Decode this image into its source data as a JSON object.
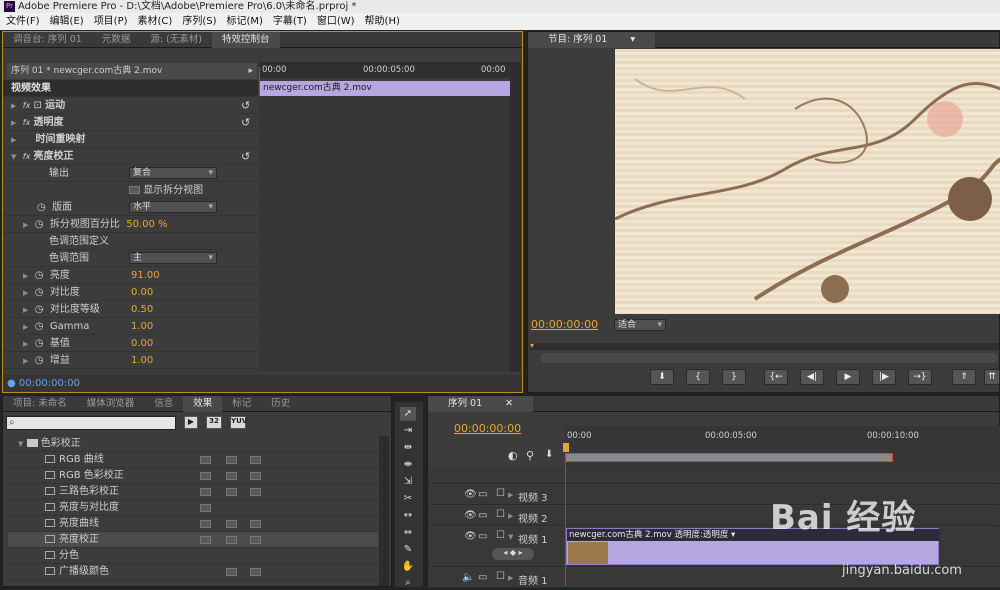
{
  "window": {
    "title": "Adobe Premiere Pro - D:\\文档\\Adobe\\Premiere Pro\\6.0\\未命名.prproj *"
  },
  "menu": [
    "文件(F)",
    "编辑(E)",
    "项目(P)",
    "素材(C)",
    "序列(S)",
    "标记(M)",
    "字幕(T)",
    "窗口(W)",
    "帮助(H)"
  ],
  "top_left_tabs": [
    "调音台: 序列 01",
    "元数据",
    "源: (无素材)",
    "特效控制台"
  ],
  "effect_controls": {
    "clip_header": "序列 01 * newcger.com古典 2.mov",
    "ruler": [
      "00:00",
      "00:00:05:00",
      "00:00"
    ],
    "clip_bar": "newcger.com古典 2.mov",
    "section": "视频效果",
    "rows": [
      {
        "label": "运动"
      },
      {
        "label": "透明度"
      },
      {
        "label": "时间重映射"
      },
      {
        "label": "亮度校正"
      }
    ],
    "props": {
      "output_label": "输出",
      "output_value": "复合",
      "split_label": "显示拆分视图",
      "layout_label": "版面",
      "layout_value": "水平",
      "split_pct_label": "拆分视图百分比",
      "split_pct_value": "50.00 %",
      "tonal_def": "色调范围定义",
      "tonal_label": "色调范围",
      "tonal_value": "主",
      "brightness_label": "亮度",
      "brightness_value": "91.00",
      "contrast_label": "对比度",
      "contrast_value": "0.00",
      "contrast_level_label": "对比度等级",
      "contrast_level_value": "0.50",
      "gamma_label": "Gamma",
      "gamma_value": "1.00",
      "pedestal_label": "基值",
      "pedestal_value": "0.00",
      "gain_label": "增益",
      "gain_value": "1.00"
    },
    "timecode": "00:00:00:00"
  },
  "program": {
    "tab": "节目: 序列 01",
    "timecode": "00:00:00:00",
    "fit": "适合"
  },
  "project_tabs": [
    "项目: 未命名",
    "媒体浏览器",
    "信息",
    "效果",
    "标记",
    "历史"
  ],
  "effects": {
    "folder": "色彩校正",
    "items": [
      "RGB 曲线",
      "RGB 色彩校正",
      "三路色彩校正",
      "亮度与对比度",
      "亮度曲线",
      "亮度校正",
      "分色",
      "广播级颜色"
    ]
  },
  "timeline": {
    "tab": "序列 01",
    "timecode": "00:00:00:00",
    "ruler": [
      "00:00",
      "00:00:05:00",
      "00:00:10:00"
    ],
    "tracks": [
      "视频 3",
      "视频 2",
      "视频 1",
      "音频 1"
    ],
    "clip_label": "newcger.com古典 2.mov  透明度:透明度 ▾"
  },
  "watermark": {
    "text": "Bai 经验",
    "url": "jingyan.baidu.com"
  }
}
